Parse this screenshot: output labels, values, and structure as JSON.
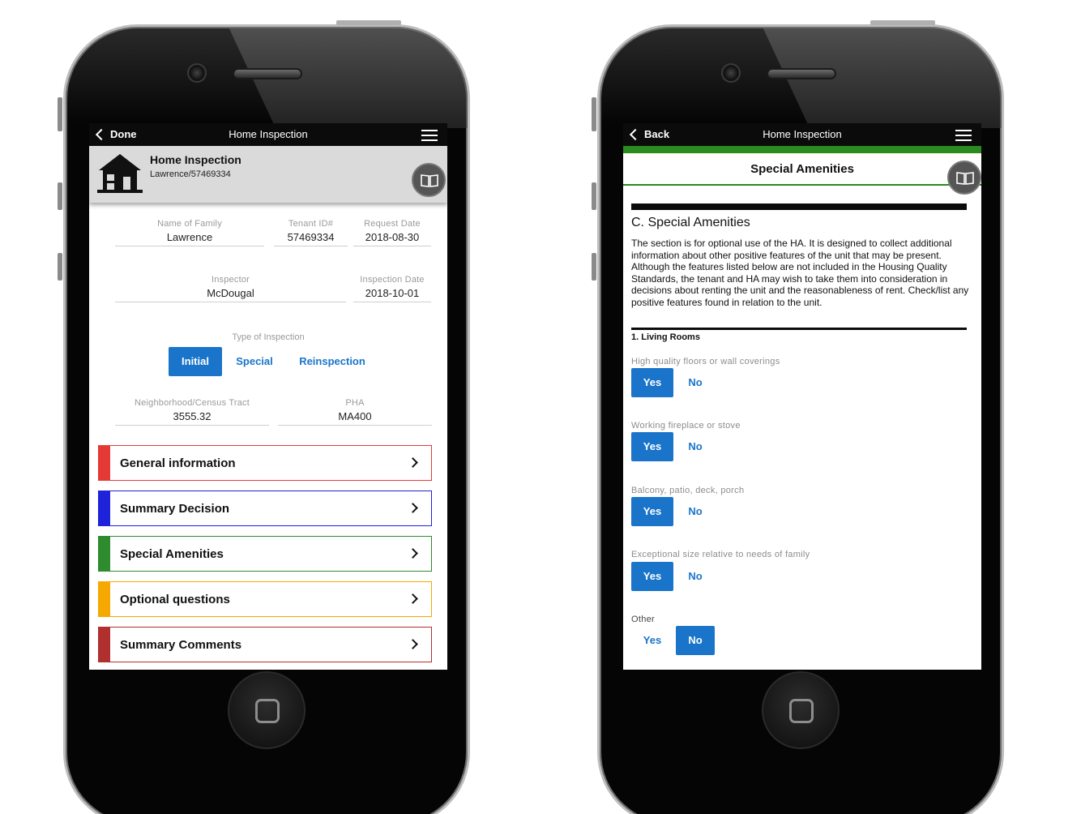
{
  "left_phone": {
    "navbar": {
      "back_label": "Done",
      "title": "Home Inspection"
    },
    "header": {
      "title": "Home Inspection",
      "subtitle": "Lawrence/57469334",
      "book_icon": "book-icon"
    },
    "fields": {
      "family": {
        "label": "Name of Family",
        "value": "Lawrence"
      },
      "tenant": {
        "label": "Tenant ID#",
        "value": "57469334"
      },
      "request": {
        "label": "Request Date",
        "value": "2018-08-30"
      },
      "inspector": {
        "label": "Inspector",
        "value": "McDougal"
      },
      "inspection_date": {
        "label": "Inspection Date",
        "value": "2018-10-01"
      },
      "census": {
        "label": "Neighborhood/Census Tract",
        "value": "3555.32"
      },
      "pha": {
        "label": "PHA",
        "value": "MA400"
      }
    },
    "inspection_type": {
      "label": "Type of Inspection",
      "options": [
        "Initial",
        "Special",
        "Reinspection"
      ],
      "selected": "Initial"
    },
    "sections": [
      {
        "label": "General information",
        "color": "#e53935"
      },
      {
        "label": "Summary Decision",
        "color": "#1e22d8"
      },
      {
        "label": "Special Amenities",
        "color": "#2e8b2e"
      },
      {
        "label": "Optional questions",
        "color": "#f5a800"
      },
      {
        "label": "Summary Comments",
        "color": "#b03030"
      }
    ]
  },
  "right_phone": {
    "navbar": {
      "back_label": "Back",
      "title": "Home Inspection"
    },
    "header": {
      "title": "Special Amenities"
    },
    "section_title": "C. Special Amenities",
    "description": "The section is for optional use of the HA. It is designed to collect additional information about other positive features of the unit that may be present. Although the features listed below are not included in the Housing Quality Standards, the tenant and HA may wish to take them into consideration in decisions about renting the unit and the reasonableness of rent. Check/list any positive features found in relation to the unit.",
    "subsection": "1. Living Rooms",
    "yes_label": "Yes",
    "no_label": "No",
    "questions": [
      {
        "label": "High quality floors or wall coverings",
        "selected": "Yes"
      },
      {
        "label": "Working fireplace or stove",
        "selected": "Yes"
      },
      {
        "label": "Balcony, patio, deck, porch",
        "selected": "Yes"
      },
      {
        "label": "Exceptional size relative to needs of family",
        "selected": "Yes"
      },
      {
        "label": "Other",
        "selected": "No"
      }
    ]
  },
  "colors": {
    "accent_blue": "#1a74c9",
    "green": "#2b8a20"
  }
}
